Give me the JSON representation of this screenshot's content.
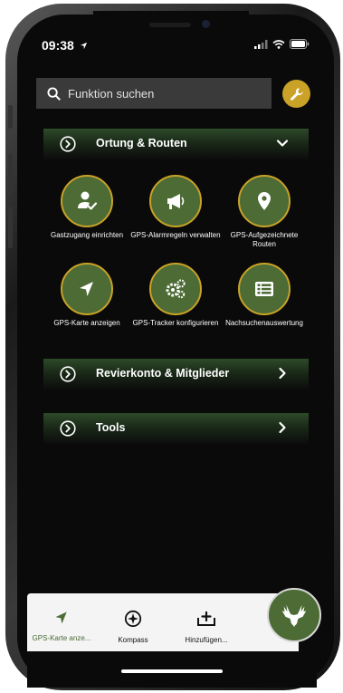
{
  "status_bar": {
    "time": "09:38"
  },
  "search": {
    "placeholder": "Funktion suchen"
  },
  "sections": {
    "ortung": {
      "label": "Ortung & Routen"
    },
    "revier": {
      "label": "Revierkonto & Mitglieder"
    },
    "tools": {
      "label": "Tools"
    }
  },
  "tiles": [
    {
      "label": "Gastzugang einrichten",
      "icon": "user-check-icon"
    },
    {
      "label": "GPS-Alarmregeln verwalten",
      "icon": "megaphone-icon"
    },
    {
      "label": "GPS-Aufgezeichnete Routen",
      "icon": "map-pin-icon"
    },
    {
      "label": "GPS-Karte anzeigen",
      "icon": "location-arrow-icon"
    },
    {
      "label": "GPS-Tracker konfigurieren",
      "icon": "gears-icon"
    },
    {
      "label": "Nachsuchenauswertung",
      "icon": "list-icon"
    }
  ],
  "bottom_nav": [
    {
      "label": "GPS-Karte anze...",
      "icon": "location-arrow-icon",
      "active": true
    },
    {
      "label": "Kompass",
      "icon": "compass-icon",
      "active": false
    },
    {
      "label": "Hinzufügen...",
      "icon": "add-tray-icon",
      "active": false
    }
  ],
  "colors": {
    "accent_green": "#4c6b35",
    "accent_gold": "#c9a227",
    "background": "#0a0a0a"
  }
}
